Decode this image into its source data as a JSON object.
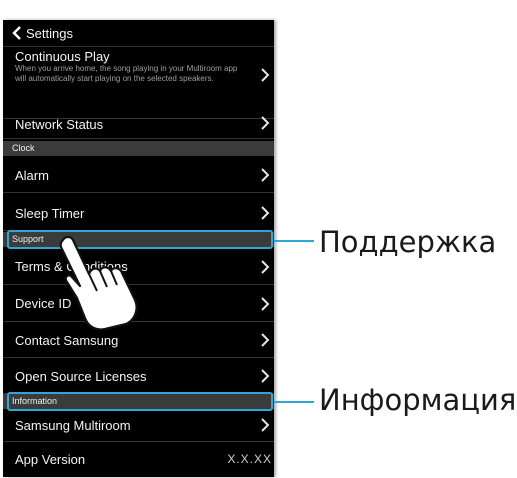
{
  "header": {
    "title": "Settings",
    "back_icon": "chevron-left-icon"
  },
  "rows": {
    "continuous_play": {
      "label": "Continuous Play",
      "description": "When you arrive home, the song playing in your Multiroom app will automatically start playing on the selected speakers."
    },
    "network_status": {
      "label": "Network Status"
    },
    "alarm": {
      "label": "Alarm"
    },
    "sleep_timer": {
      "label": "Sleep Timer"
    },
    "terms": {
      "label": "Terms & Conditions"
    },
    "device_id": {
      "label": "Device ID"
    },
    "contact_samsung": {
      "label": "Contact Samsung"
    },
    "open_source": {
      "label": "Open Source Licenses"
    },
    "samsung_multiroom": {
      "label": "Samsung Multiroom"
    },
    "app_version": {
      "label": "App Version",
      "value": "X.X.XX"
    }
  },
  "sections": {
    "clock": "Clock",
    "support": "Support",
    "information": "Information"
  },
  "callouts": {
    "support": "Поддержка",
    "information": "Информация"
  },
  "colors": {
    "background": "#000000",
    "section_bg": "#3b3b3b",
    "highlight": "#2ea6d8",
    "text": "#f3f3f3",
    "secondary_text": "#9e9e9e"
  },
  "icons": {
    "row_arrow": "chevron-right-icon",
    "pointer": "pointing-hand-icon"
  }
}
